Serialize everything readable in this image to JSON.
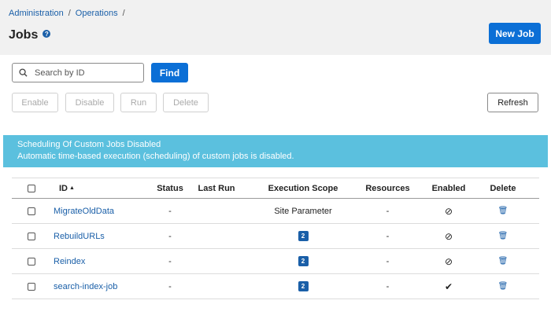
{
  "breadcrumb": {
    "items": [
      "Administration",
      "Operations"
    ],
    "separator": "/"
  },
  "header": {
    "title": "Jobs",
    "help_icon": "?",
    "new_job_label": "New Job"
  },
  "search": {
    "placeholder": "Search by ID",
    "value": "",
    "find_label": "Find"
  },
  "actions": {
    "enable": "Enable",
    "disable": "Disable",
    "run": "Run",
    "delete": "Delete",
    "refresh": "Refresh"
  },
  "alert": {
    "title": "Scheduling Of Custom Jobs Disabled",
    "message": "Automatic time-based execution (scheduling) of custom jobs is disabled."
  },
  "table": {
    "headers": {
      "id": "ID",
      "status": "Status",
      "last_run": "Last Run",
      "execution_scope": "Execution Scope",
      "resources": "Resources",
      "enabled": "Enabled",
      "delete": "Delete"
    },
    "sort_icon": "▲",
    "enabled_glyphs": {
      "disabled": "⊘",
      "enabled": "✔"
    },
    "delete_glyph": "🗑",
    "rows": [
      {
        "id": "MigrateOldData",
        "status": "-",
        "last_run": "",
        "scope_text": "Site Parameter",
        "scope_badge": "",
        "resources": "-",
        "enabled": "disabled"
      },
      {
        "id": "RebuildURLs",
        "status": "-",
        "last_run": "",
        "scope_text": "",
        "scope_badge": "2",
        "resources": "-",
        "enabled": "disabled"
      },
      {
        "id": "Reindex",
        "status": "-",
        "last_run": "",
        "scope_text": "",
        "scope_badge": "2",
        "resources": "-",
        "enabled": "disabled"
      },
      {
        "id": "search-index-job",
        "status": "-",
        "last_run": "",
        "scope_text": "",
        "scope_badge": "2",
        "resources": "-",
        "enabled": "enabled"
      }
    ]
  },
  "colors": {
    "primary": "#0b6fd6",
    "link": "#1a5fa8",
    "alert_bg": "#5bc0de",
    "header_bg": "#f1f1f1"
  }
}
